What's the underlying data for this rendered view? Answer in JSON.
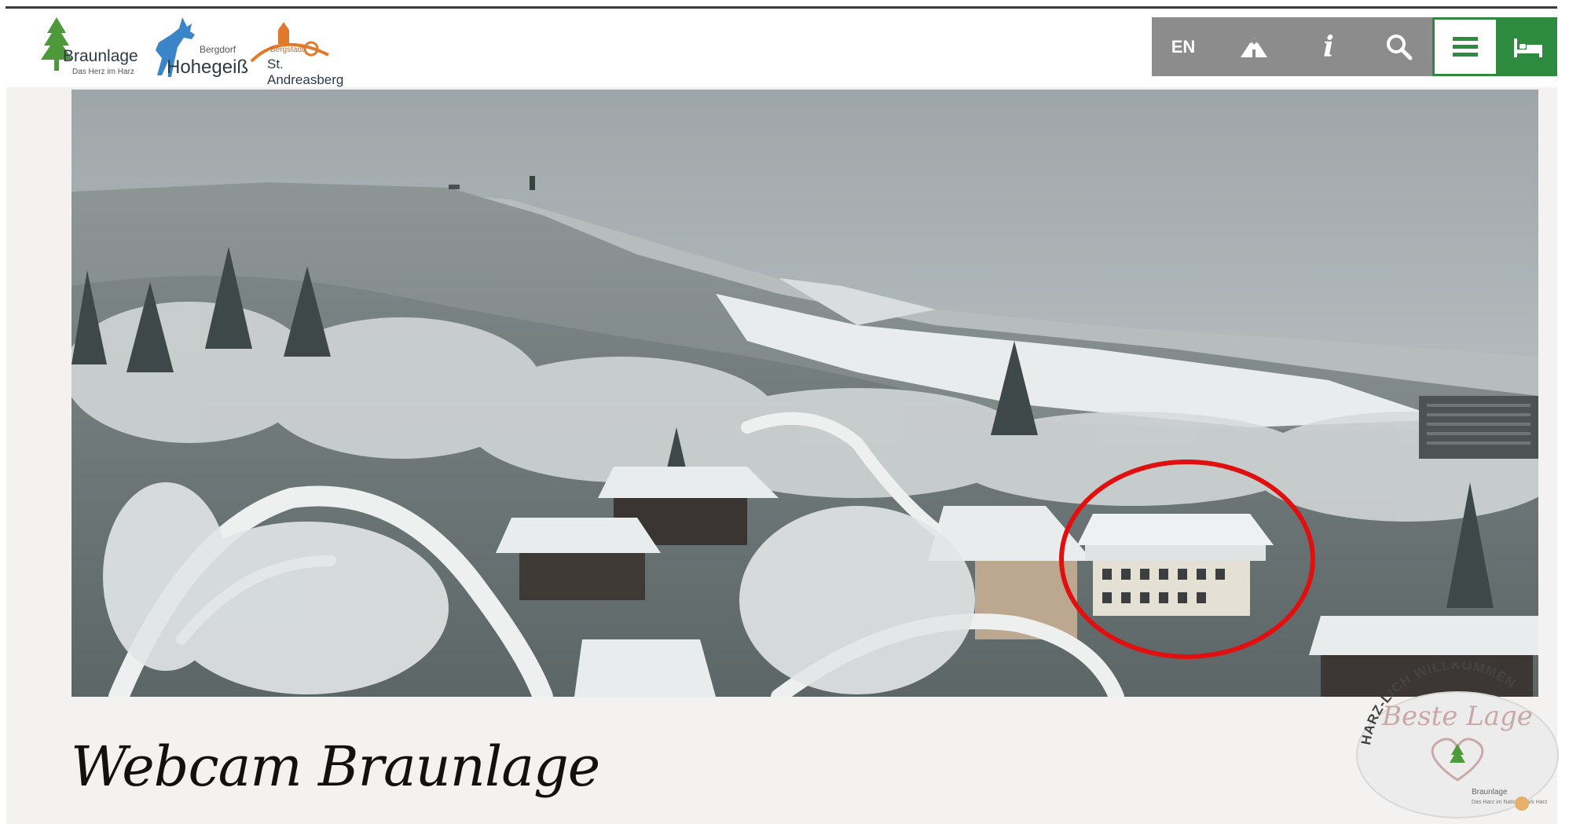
{
  "header": {
    "logos": [
      {
        "name": "Braunlage",
        "tagline": "Das Herz im Harz"
      },
      {
        "name": "Hohegeiß",
        "prefix": "Bergdorf"
      },
      {
        "name": "St. Andreasberg",
        "prefix": "Bergstadt"
      }
    ],
    "toolbar": {
      "lang_label": "EN",
      "info_label": "i",
      "icons": [
        "mountain-icon",
        "info-icon",
        "search-icon",
        "menu-icon",
        "bed-icon"
      ],
      "accent": "#2e8a3e",
      "bar_color": "#8c8c8c"
    }
  },
  "webcam": {
    "image": "snow-covered-forest-webcam",
    "highlight": "red-circle"
  },
  "page": {
    "title": "Webcam Braunlage"
  },
  "badge": {
    "arc_text": "HARZ-LICH WILLKOMMEN",
    "headline": "Beste Lage",
    "town": "Braunlage",
    "town_tagline": "Das Harz im Nationalpark Harz"
  }
}
